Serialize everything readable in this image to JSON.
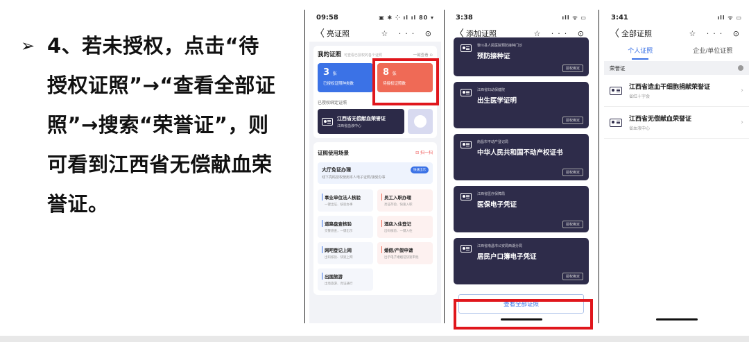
{
  "instruction": {
    "bullet": "➢",
    "text": "4、若未授权，点击“待授权证照”→“查看全部证照”→搜索“荣誉证”，则可看到江西省无偿献血荣誉证。"
  },
  "phone1": {
    "status": {
      "time": "09:58",
      "icons": "▣ ✱ ⁘ ıl ıl 80 ▾"
    },
    "nav": {
      "back": "〈",
      "title": "亮证照",
      "ops": "☆ ··· ⊙"
    },
    "my_certs": {
      "title": "我的证照",
      "hint": "可查看已授权的各个证照",
      "all": "一键查看 ⊙",
      "authorized": {
        "num": "3",
        "unit": "张",
        "label": "已授权证照种类数"
      },
      "pending": {
        "num": "8",
        "unit": "张",
        "label": "待授权证照数"
      }
    },
    "bound": {
      "label": "已授权绑定证照",
      "title": "江西省无偿献血荣誉证",
      "sub": "江西省血液中心"
    },
    "scenes": {
      "title": "证照使用场景",
      "link": "⊟ 扫一扫",
      "hall": {
        "title": "大厅免证办理",
        "sub": "线下亮码授权使用本人电子证照/接受办事",
        "tag": "快速出示"
      },
      "items": [
        {
          "title": "事业单位法人核验",
          "sub": "一键出证、核验办事"
        },
        {
          "title": "员工入职办理",
          "sub": "亮证存验、快速入职"
        },
        {
          "title": "道路盘查核验",
          "sub": "交警盘查，一键出示"
        },
        {
          "title": "酒店入住登记",
          "sub": "出码核验、一键入住"
        },
        {
          "title": "网吧登记上网",
          "sub": "出码核验、快速上网"
        },
        {
          "title": "婚假/产假申请",
          "sub": "出示电子婚姻证快速审批"
        },
        {
          "title": "出国旅游",
          "sub": "出境旅游、亮证通行"
        }
      ]
    }
  },
  "phone2": {
    "status": {
      "time": "3:38",
      "icons": "ıll ᯤ ▭"
    },
    "nav": {
      "back": "〈",
      "title": "添加证照",
      "ops": "☆ ··· ⊙"
    },
    "certs": [
      {
        "issuer": "黎川县人民医院预防接种门诊",
        "name": "预防接种证",
        "action": "授权绑定"
      },
      {
        "issuer": "江西省妇幼保健院",
        "name": "出生医学证明",
        "action": "授权绑定"
      },
      {
        "issuer": "南昌市不动产登记局",
        "name": "中华人民共和国不动产权证书",
        "action": "授权绑定"
      },
      {
        "issuer": "江西省医疗保障局",
        "name": "医保电子凭证",
        "action": "授权绑定"
      },
      {
        "issuer": "江西省南昌市公安局西湖分局",
        "name": "居民户口簿电子凭证",
        "action": "授权绑定"
      }
    ],
    "view_all": "查看全部证照"
  },
  "phone3": {
    "status": {
      "time": "3:41",
      "icons": "ıll ᯤ ▭"
    },
    "nav": {
      "back": "〈",
      "title": "全部证照",
      "ops": "☆ ··· ⊙"
    },
    "tabs": [
      "个人证照",
      "企业/单位证照"
    ],
    "search": "荣誉证",
    "results": [
      {
        "title": "江西省造血干细胞捐献荣誉证",
        "sub": "省红十字会"
      },
      {
        "title": "江西省无偿献血荣誉证",
        "sub": "省血液中心"
      }
    ]
  }
}
